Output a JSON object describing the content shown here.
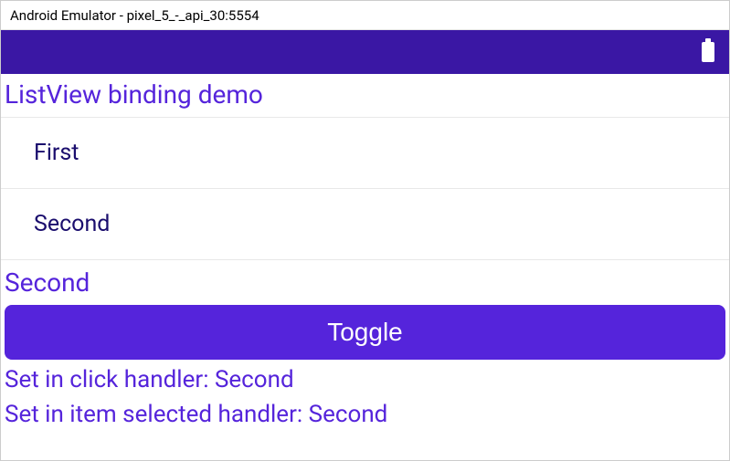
{
  "window": {
    "title": "Android Emulator - pixel_5_-_api_30:5554"
  },
  "statusbar": {
    "battery": "battery-full"
  },
  "app": {
    "title": "ListView binding demo",
    "list_items": [
      {
        "label": "First"
      },
      {
        "label": "Second"
      }
    ],
    "selected_value": "Second",
    "toggle_label": "Toggle",
    "click_handler_text": "Set in click handler: Second",
    "item_selected_handler_text": "Set in item selected handler: Second"
  },
  "colors": {
    "accent": "#5524db",
    "status_bar": "#3a17a4",
    "list_text": "#1a0d6d"
  }
}
